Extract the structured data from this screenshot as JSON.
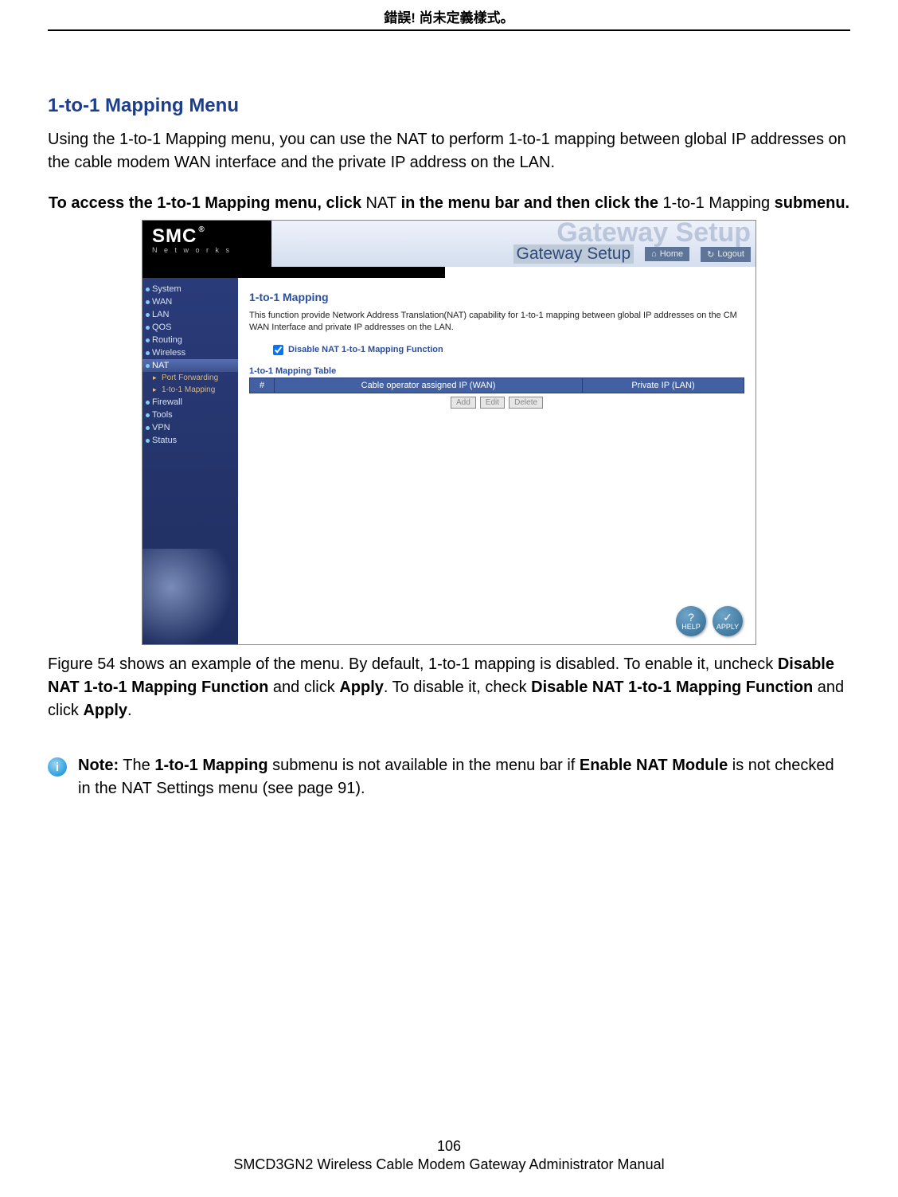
{
  "header": {
    "error_text": "錯誤! 尚未定義樣式。"
  },
  "doc": {
    "section_title": "1-to-1 Mapping Menu",
    "intro": "Using the 1-to-1 Mapping menu, you can use the NAT to perform 1-to-1 mapping between global IP addresses on the cable modem WAN interface and the private IP address on the LAN.",
    "access_pre": "To access the 1-to-1 Mapping menu, click ",
    "access_nat": "NAT",
    "access_mid": " in the menu bar and then click the ",
    "access_sub": "1-to-1 Mapping",
    "access_post": " submenu.",
    "fig_paragraph_1": "Figure 54 shows an example of the menu. By default, 1-to-1 mapping is disabled. To enable it, uncheck ",
    "fig_bold_1": "Disable NAT 1-to-1 Mapping Function",
    "fig_mid_1": " and click ",
    "fig_bold_2": "Apply",
    "fig_mid_2": ". To disable it, check ",
    "fig_bold_3": "Disable NAT 1-to-1 Mapping Function",
    "fig_mid_3": " and click ",
    "fig_bold_4": "Apply",
    "fig_end": ".",
    "note_label": "Note:",
    "note_1": " The ",
    "note_bold_1": "1-to-1 Mapping",
    "note_2": " submenu is not available in the menu bar if ",
    "note_bold_2": "Enable NAT Module",
    "note_3": " is not checked in the NAT Settings menu (see page 91)."
  },
  "shot": {
    "logo_main": "SMC",
    "logo_reg": "®",
    "logo_sub": "N e t w o r k s",
    "gw_ghost": "Gateway Setup",
    "gw_title": "Gateway Setup",
    "home_label": "Home",
    "logout_label": "Logout",
    "sidebar": {
      "items": [
        "System",
        "WAN",
        "LAN",
        "QOS",
        "Routing",
        "Wireless",
        "NAT",
        "Firewall",
        "Tools",
        "VPN",
        "Status"
      ],
      "subs": [
        "Port Forwarding",
        "1-to-1 Mapping"
      ]
    },
    "main": {
      "title": "1-to-1 Mapping",
      "desc": "This function provide Network Address Translation(NAT) capability for 1-to-1 mapping between global IP addresses on the CM WAN Interface and private IP addresses on the LAN.",
      "checkbox_label": "Disable NAT 1-to-1 Mapping Function",
      "table_title": "1-to-1 Mapping Table",
      "col1": "#",
      "col2": "Cable operator assigned IP (WAN)",
      "col3": "Private IP (LAN)",
      "btn_add": "Add",
      "btn_edit": "Edit",
      "btn_delete": "Delete",
      "help_label": "HELP",
      "apply_label": "APPLY"
    }
  },
  "footer": {
    "page_no": "106",
    "title": "SMCD3GN2 Wireless Cable Modem Gateway Administrator Manual"
  }
}
